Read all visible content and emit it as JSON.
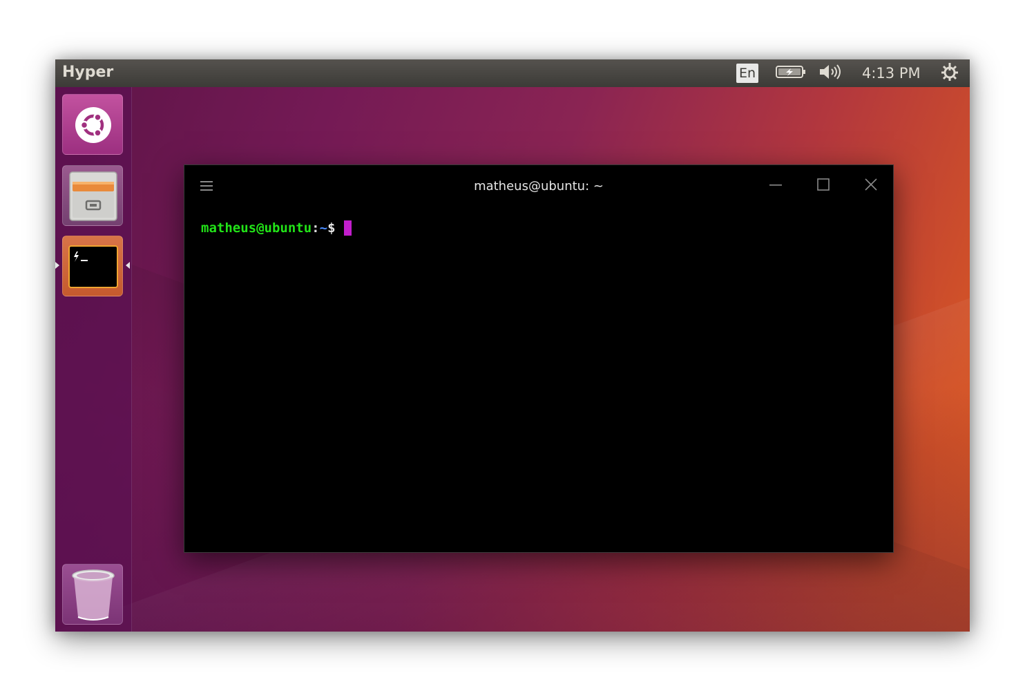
{
  "top_panel": {
    "app_title": "Hyper",
    "keyboard_layout": "En",
    "battery_icon": "battery-charging-icon",
    "volume_icon": "volume-icon",
    "clock": "4:13 PM",
    "power_icon": "system-gear-icon"
  },
  "launcher": {
    "items": [
      {
        "name": "Dash",
        "icon": "ubuntu-logo-icon"
      },
      {
        "name": "Files",
        "icon": "file-cabinet-icon"
      },
      {
        "name": "Hyper",
        "icon": "terminal-icon",
        "active": true
      },
      {
        "name": "Trash",
        "icon": "trash-icon"
      }
    ]
  },
  "terminal": {
    "title": "matheus@ubuntu: ~",
    "menu_icon": "hamburger-menu-icon",
    "prompt_user": "matheus@ubuntu",
    "prompt_colon": ":",
    "prompt_path": "~",
    "prompt_symbol": "$",
    "colors": {
      "user": "#22e318",
      "path": "#4a8cff",
      "cursor": "#c21ecc",
      "background": "#000000"
    }
  },
  "theme": {
    "accent": "#dd4814",
    "launcher_bg": "#5c1052",
    "panel_bg": "#3c3b37"
  }
}
